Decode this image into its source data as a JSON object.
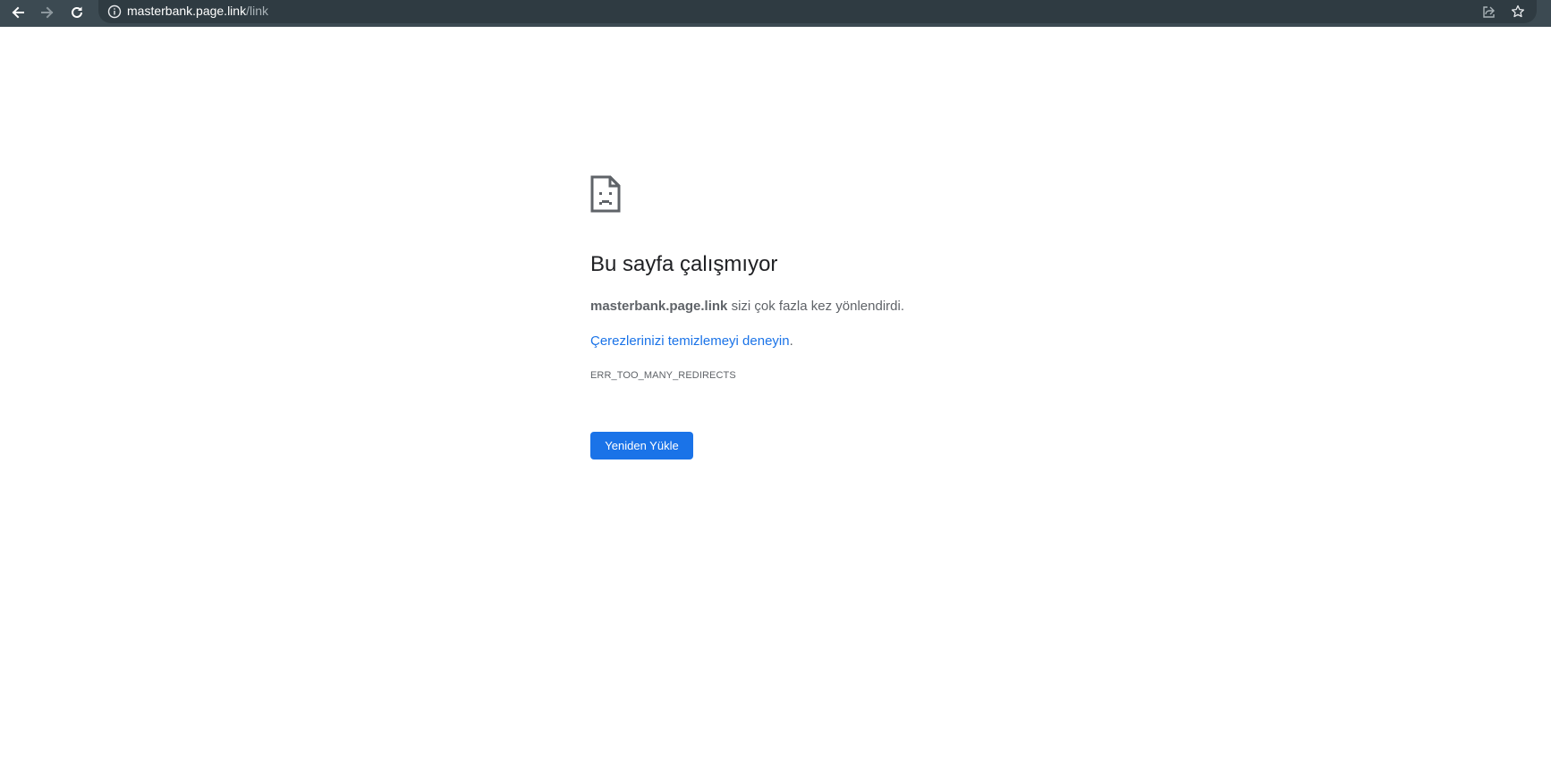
{
  "browser": {
    "url_host": "masterbank.page.link",
    "url_path": "/link",
    "icons": {
      "back": "arrow-left-icon",
      "forward": "arrow-right-icon",
      "reload": "reload-icon",
      "site_info": "info-icon",
      "share": "share-icon",
      "bookmark": "star-icon"
    }
  },
  "error_page": {
    "icon": "sad-page-icon",
    "title": "Bu sayfa çalışmıyor",
    "host_bold": "masterbank.page.link",
    "description_rest": " sizi çok fazla kez yönlendirdi.",
    "suggestion_link": "Çerezlerinizi temizlemeyi deneyin",
    "suggestion_period": ".",
    "error_code": "ERR_TOO_MANY_REDIRECTS",
    "reload_button": "Yeniden Yükle"
  },
  "colors": {
    "toolbar_bg": "#3c4a52",
    "omnibox_bg": "#2f3b42",
    "link": "#1a73e8",
    "button_bg": "#1a73e8",
    "title_text": "#202124",
    "body_text": "#5f6368"
  }
}
